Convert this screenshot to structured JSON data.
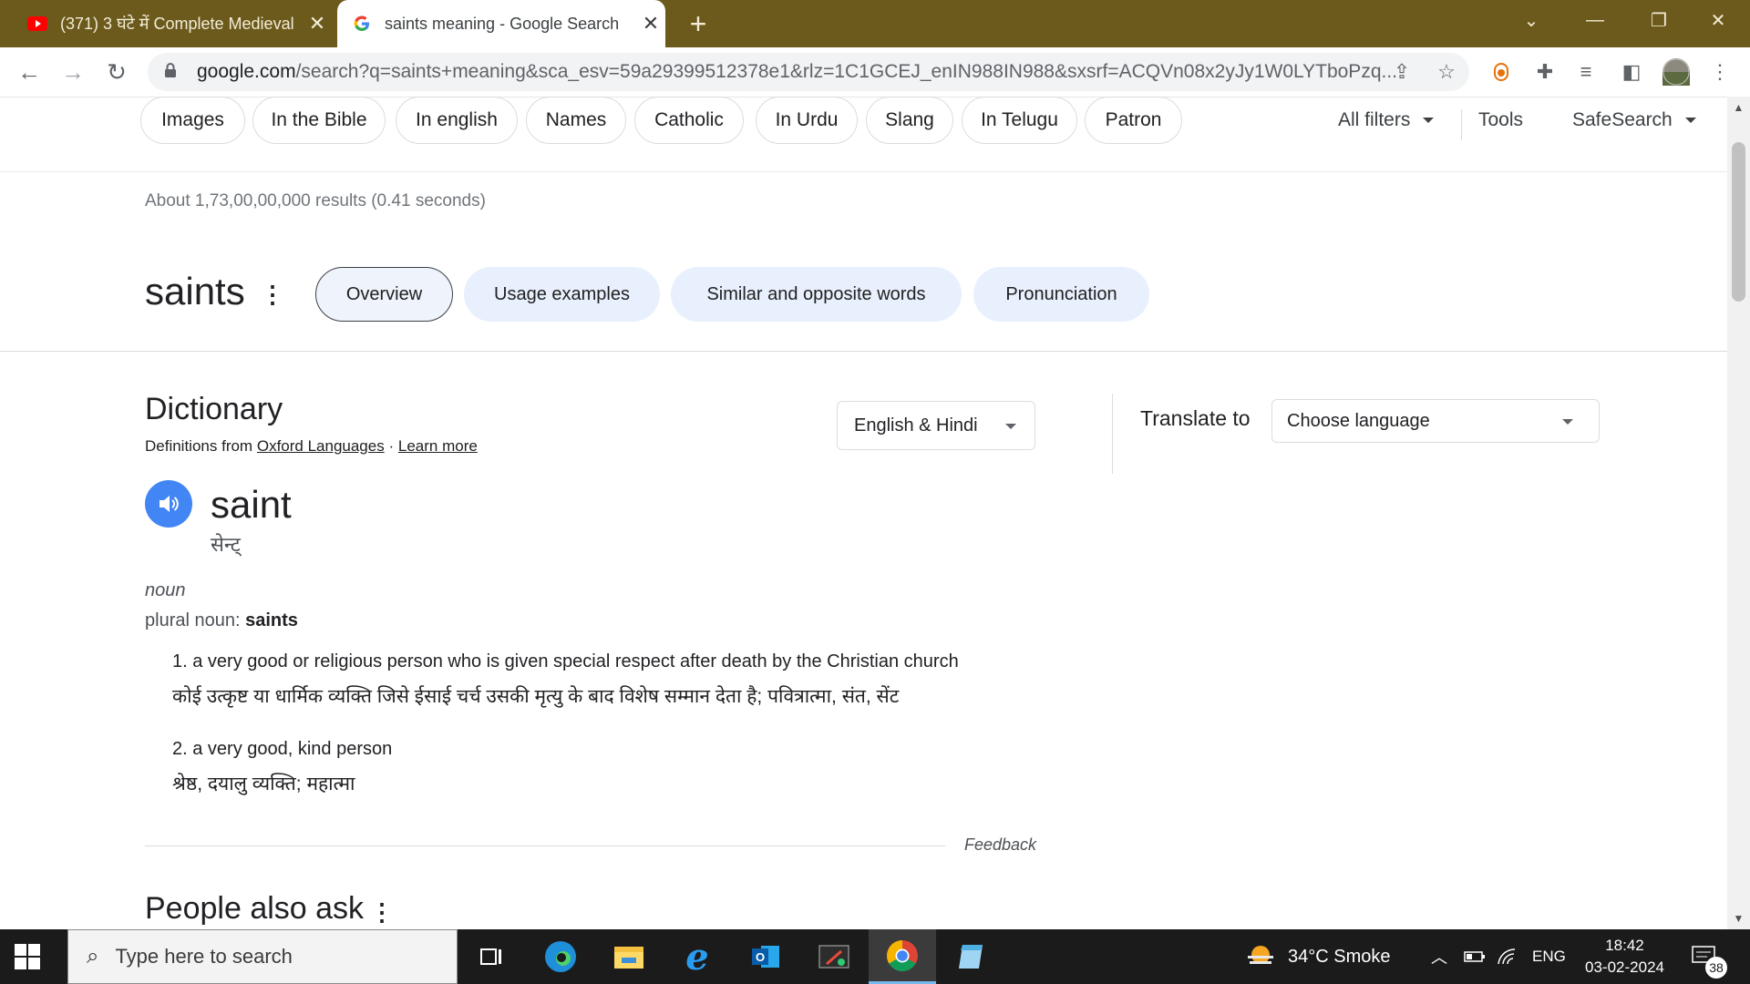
{
  "browser": {
    "tabs": [
      {
        "title": "(371) 3 घंटे में Complete Medieval",
        "favicon": "youtube-icon",
        "active": false
      },
      {
        "title": "saints meaning - Google Search",
        "favicon": "google-g-icon",
        "active": true
      }
    ],
    "url_main": "google.com",
    "url_rest": "/search?q=saints+meaning&sca_esv=59a29399512378e1&rlz=1C1GCEJ_enIN988IN988&sxsrf=ACQVn08x2yJy1W0LYTboPzq..."
  },
  "filters": {
    "chips": [
      "Images",
      "In the Bible",
      "In english",
      "Names",
      "Catholic",
      "In Urdu",
      "Slang",
      "In Telugu",
      "Patron"
    ],
    "all_filters": "All filters",
    "tools": "Tools",
    "safesearch": "SafeSearch"
  },
  "results_count": "About 1,73,00,00,000 results (0.41 seconds)",
  "word_header": {
    "word": "saints",
    "pills": [
      "Overview",
      "Usage examples",
      "Similar and opposite words",
      "Pronunciation"
    ],
    "selected": "Overview"
  },
  "dictionary": {
    "title": "Dictionary",
    "source_prefix": "Definitions from",
    "source_link": "Oxford Languages",
    "separator": "·",
    "learn_more": "Learn more",
    "language_select": "English & Hindi",
    "translate_label": "Translate to",
    "translate_placeholder": "Choose language",
    "headword": "saint",
    "phonetic": "सेन्ट्",
    "part_of_speech": "noun",
    "plural_label": "plural noun:",
    "plural_value": "saints",
    "definitions": [
      {
        "en": "1. a very good or religious person who is given special respect after death by the Christian church",
        "hi": "कोई उत्कृष्ट या धार्मिक व्यक्ति जिसे ईसाई चर्च उसकी मृत्यु के बाद विशेष सम्मान देता है; पवित्रात्मा, संत, सेंट"
      },
      {
        "en": "2. a very good, kind person",
        "hi": "श्रेष्ठ, दयालु व्यक्ति; महात्मा"
      }
    ],
    "feedback": "Feedback"
  },
  "people_also_ask": "People also ask",
  "taskbar": {
    "search_placeholder": "Type here to search",
    "weather": "34°C  Smoke",
    "language": "ENG",
    "time": "18:42",
    "date": "03-02-2024",
    "notifications": "38"
  }
}
